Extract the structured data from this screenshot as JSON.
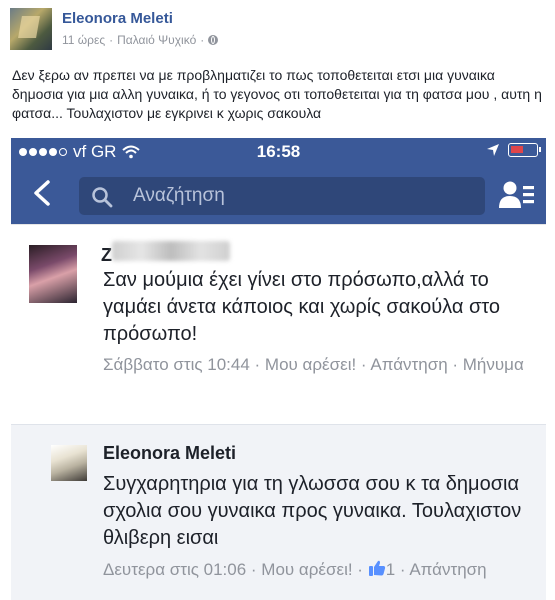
{
  "post": {
    "author": "Eleonora Meleti",
    "time": "11 ώρες",
    "separator": "·",
    "location": "Παλαιό Ψυχικό",
    "text": "Δεν ξερω αν πρεπει να με προβληματιζει το πως τοποθετειται ετσι μια γυναικα δημοσια για μια αλλη γυναικα, ή το γεγονος οτι τοποθετειται για τη φατσα μου , αυτη η φατσα... Τουλαχιστον με εγκρινει κ χωρις σακουλα"
  },
  "phone": {
    "carrier": "vf GR",
    "time": "16:58",
    "search_placeholder": "Αναζήτηση"
  },
  "comments": [
    {
      "name_visible": "Z",
      "text": "Σαν μούμια έχει γίνει στο πρόσωπο,αλλά το γαμάει άνετα κάποιος και χωρίς σακούλα στο πρόσωπο!",
      "meta": "Σάββατο στις 10:44 · Μου αρέσει! · Απάντηση · Μήνυμα"
    },
    {
      "name": "Eleonora Meleti",
      "text": "Συγχαρητηρια για τη γλωσσα σου κ τα δημοσια σχολια σου γυναικα προς γυναικα. Τουλαχιστον θλιβερη εισαι",
      "meta_prefix": "Δευτερα στις 01:06 · Μου αρέσει! · ",
      "like_count": "1",
      "meta_suffix": " · Απάντηση"
    }
  ],
  "colors": {
    "facebook_blue": "#3b5998",
    "link_blue": "#365899",
    "gray_text": "#90949c"
  },
  "icons": [
    "globe-icon",
    "wifi-icon",
    "location-arrow-icon",
    "battery-icon",
    "back-arrow-icon",
    "search-icon",
    "friends-icon",
    "like-thumb-icon"
  ]
}
